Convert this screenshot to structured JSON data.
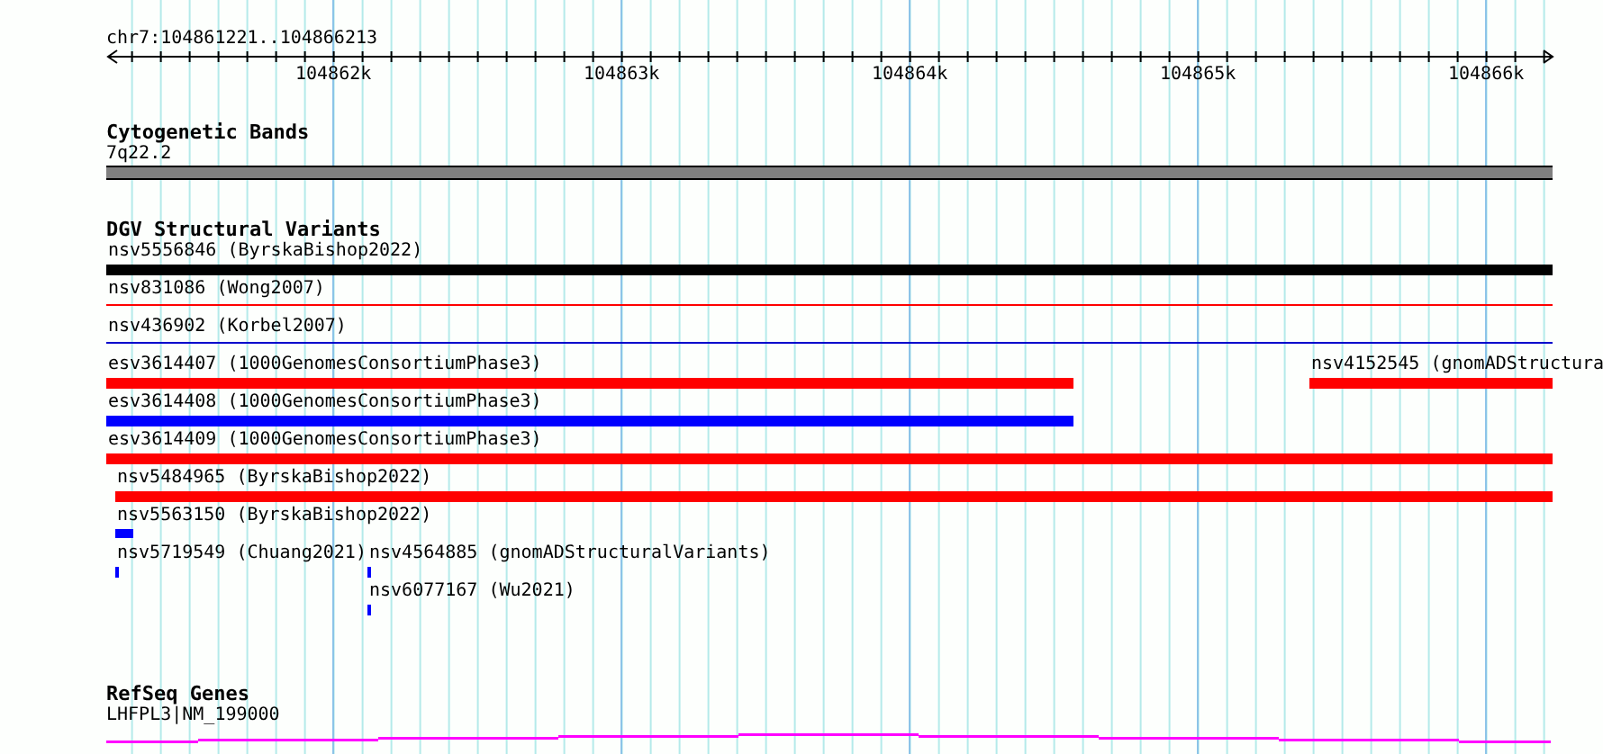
{
  "ruler": {
    "location": "chr7:104861221..104866213",
    "ticks": [
      "104862k",
      "104863k",
      "104864k",
      "104865k",
      "104866k"
    ]
  },
  "cytogenetic_bands": {
    "title": "Cytogenetic Bands",
    "band_label": "7q22.2"
  },
  "dgv_track": {
    "title": "DGV Structural Variants",
    "features": [
      {
        "label": "nsv5556846 (ByrskaBishop2022)",
        "kind": "bar",
        "color": "#000000"
      },
      {
        "label": "nsv831086 (Wong2007)",
        "kind": "line",
        "color": "#ff0000"
      },
      {
        "label": "nsv436902 (Korbel2007)",
        "kind": "line",
        "color": "#0000cc"
      },
      {
        "label": "esv3614407 (1000GenomesConsortiumPhase3)",
        "kind": "bar",
        "color": "#ff0000"
      },
      {
        "label": "nsv4152545 (gnomADStructura",
        "kind": "bar",
        "color": "#ff0000"
      },
      {
        "label": "esv3614408 (1000GenomesConsortiumPhase3)",
        "kind": "bar",
        "color": "#0000ff"
      },
      {
        "label": "esv3614409 (1000GenomesConsortiumPhase3)",
        "kind": "bar",
        "color": "#ff0000"
      },
      {
        "label": "nsv5484965 (ByrskaBishop2022)",
        "kind": "bar",
        "color": "#ff0000"
      },
      {
        "label": "nsv5563150 (ByrskaBishop2022)",
        "kind": "bar",
        "color": "#0000ff"
      },
      {
        "label": "nsv5719549 (Chuang2021)",
        "kind": "bar",
        "color": "#0000ff"
      },
      {
        "label": "nsv4564885 (gnomADStructuralVariants)",
        "kind": "bar",
        "color": "#0000ff"
      },
      {
        "label": "nsv6077167 (Wu2021)",
        "kind": "bar",
        "color": "#0000ff"
      }
    ]
  },
  "refseq_track": {
    "title": "RefSeq Genes",
    "gene_label": "LHFPL3|NM_199000"
  }
}
